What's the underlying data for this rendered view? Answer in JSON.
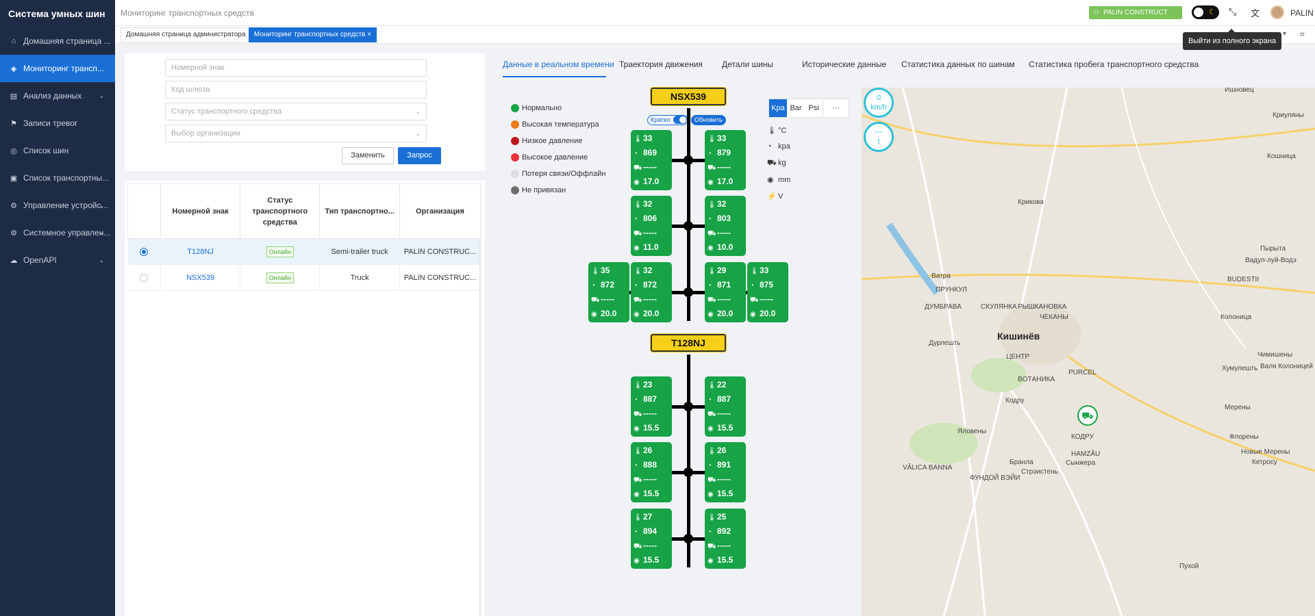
{
  "app_title": "Система умных шин",
  "sidebar": {
    "items": [
      {
        "label": "Домашняя страница ...",
        "icon": "home-icon",
        "active": false,
        "chevron": false
      },
      {
        "label": "Мониторинг трансп...",
        "icon": "monitor-icon",
        "active": true,
        "chevron": false
      },
      {
        "label": "Анализ данных",
        "icon": "analysis-icon",
        "active": false,
        "chevron": true
      },
      {
        "label": "Записи тревог",
        "icon": "alarm-icon",
        "active": false,
        "chevron": false
      },
      {
        "label": "Список шин",
        "icon": "tire-list-icon",
        "active": false,
        "chevron": false
      },
      {
        "label": "Список транспортны...",
        "icon": "vehicle-list-icon",
        "active": false,
        "chevron": false
      },
      {
        "label": "Управление устройс...",
        "icon": "device-icon",
        "active": false,
        "chevron": true
      },
      {
        "label": "Системное управлен...",
        "icon": "system-icon",
        "active": false,
        "chevron": true
      },
      {
        "label": "OpenAPI",
        "icon": "cloud-icon",
        "active": false,
        "chevron": true
      }
    ]
  },
  "header": {
    "breadcrumb": "Мониторинг транспортных средств",
    "org_badge": "PALIN CONSTRUCT SRL",
    "username": "PALIN"
  },
  "tabs": [
    {
      "label": "Домашняя страница администратора",
      "active": false
    },
    {
      "label": "Мониторинг транспортных средств ×",
      "active": true
    }
  ],
  "tooltip": "Выйти из полного экрана",
  "filters": {
    "plate_placeholder": "Номерной знак",
    "gateway_placeholder": "Код шлюза",
    "status_placeholder": "Статус транспортного средства",
    "org_placeholder": "Выбор организации",
    "reset_label": "Заменить",
    "query_label": "Запрос"
  },
  "table": {
    "headers": [
      "Номерной знак",
      "Статус транспортного средства",
      "Тип транспортно...",
      "Организация"
    ],
    "rows": [
      {
        "plate": "T128NJ",
        "status": "Онлайн",
        "type": "Semi-trailer truck",
        "org": "PALIN CONSTRUC...",
        "selected": true
      },
      {
        "plate": "NSX539",
        "status": "Онлайн",
        "type": "Truck",
        "org": "PALIN CONSTRUC...",
        "selected": false
      }
    ]
  },
  "detail_tabs": [
    {
      "label": "Данные в реальном времени",
      "active": true
    },
    {
      "label": "Траектория движения",
      "active": false
    },
    {
      "label": "Детали шины",
      "active": false
    },
    {
      "label": "Исторические данные",
      "active": false
    },
    {
      "label": "Статистика данных по шинам",
      "active": false
    },
    {
      "label": "Статистика пробега транспортного средства",
      "active": false
    }
  ],
  "legend": [
    {
      "label": "Нормально",
      "color": "#17a346"
    },
    {
      "label": "Высокая температура",
      "color": "#f07a16"
    },
    {
      "label": "Низкое давление",
      "color": "#c0171c"
    },
    {
      "label": "Высокое давление",
      "color": "#e8323a"
    },
    {
      "label": "Потеря связи/Оффлайн",
      "color": "#dcdfe6"
    },
    {
      "label": "Не привязан",
      "color": "#6e6e6e"
    }
  ],
  "controls": {
    "brief_label": "Кратко",
    "refresh_label": "Обновить"
  },
  "units": {
    "pressure_buttons": [
      "Kpa",
      "Bar",
      "Psi",
      "···"
    ],
    "active_unit": "Kpa",
    "legend": [
      {
        "icon": "thermometer-icon",
        "label": "°C"
      },
      {
        "icon": "pressure-icon",
        "label": "kpa"
      },
      {
        "icon": "load-icon",
        "label": "kg"
      },
      {
        "icon": "tread-icon",
        "label": "mm"
      },
      {
        "icon": "voltage-icon",
        "label": "V"
      }
    ]
  },
  "vehicles": [
    {
      "plate": "NSX539",
      "axles": [
        {
          "left": [
            {
              "temp": "33",
              "pressure": "869",
              "load": "-----",
              "tread": "17.0"
            }
          ],
          "right": [
            {
              "temp": "33",
              "pressure": "879",
              "load": "-----",
              "tread": "17.0"
            }
          ]
        },
        {
          "left": [
            {
              "temp": "32",
              "pressure": "806",
              "load": "-----",
              "tread": "11.0"
            }
          ],
          "right": [
            {
              "temp": "32",
              "pressure": "803",
              "load": "-----",
              "tread": "10.0"
            }
          ]
        },
        {
          "left": [
            {
              "temp": "35",
              "pressure": "872",
              "load": "-----",
              "tread": "20.0"
            },
            {
              "temp": "32",
              "pressure": "872",
              "load": "-----",
              "tread": "20.0"
            }
          ],
          "right": [
            {
              "temp": "29",
              "pressure": "871",
              "load": "-----",
              "tread": "20.0"
            },
            {
              "temp": "33",
              "pressure": "875",
              "load": "-----",
              "tread": "20.0"
            }
          ]
        }
      ]
    },
    {
      "plate": "T128NJ",
      "axles": [
        {
          "left": [
            {
              "temp": "23",
              "pressure": "887",
              "load": "-----",
              "tread": "15.5"
            }
          ],
          "right": [
            {
              "temp": "22",
              "pressure": "887",
              "load": "-----",
              "tread": "15.5"
            }
          ]
        },
        {
          "left": [
            {
              "temp": "26",
              "pressure": "888",
              "load": "-----",
              "tread": "15.5"
            }
          ],
          "right": [
            {
              "temp": "26",
              "pressure": "891",
              "load": "-----",
              "tread": "15.5"
            }
          ]
        },
        {
          "left": [
            {
              "temp": "27",
              "pressure": "894",
              "load": "-----",
              "tread": "15.5"
            }
          ],
          "right": [
            {
              "temp": "25",
              "pressure": "892",
              "load": "-----",
              "tread": "15.5"
            }
          ]
        }
      ]
    }
  ],
  "map": {
    "speed_value": "0",
    "speed_unit": "km/h",
    "load_value": "---",
    "load_unit": "t",
    "labels": [
      "Ишновец",
      "Криуляны",
      "Кошница",
      "Крикова",
      "Пырыта",
      "Вадул-луй-Водэ",
      "Ватра",
      "ПРУНКУЛ",
      "ДУМБРАВА",
      "СКУЛЯНКА",
      "РЫШКАНОВКА",
      "ЧЕКАНЫ",
      "Колоница",
      "BUDESTII",
      "Кишинёв",
      "Дурлешть",
      "ЦЕНТР",
      "Чимишены",
      "Валя Колоницей",
      "Хумулешть",
      "BOTАНИКА",
      "PURCEL",
      "Кодру",
      "Мерены",
      "Яловены",
      "КОДРУ",
      "Флорены",
      "Бранла",
      "Сынжера",
      "Новые Мерены",
      "Кетросу",
      "Стрэистень",
      "HAMZĂU",
      "VĂLICA BANNA",
      "ФУНДОЙ ВЭЙИ",
      "Пухой"
    ]
  }
}
